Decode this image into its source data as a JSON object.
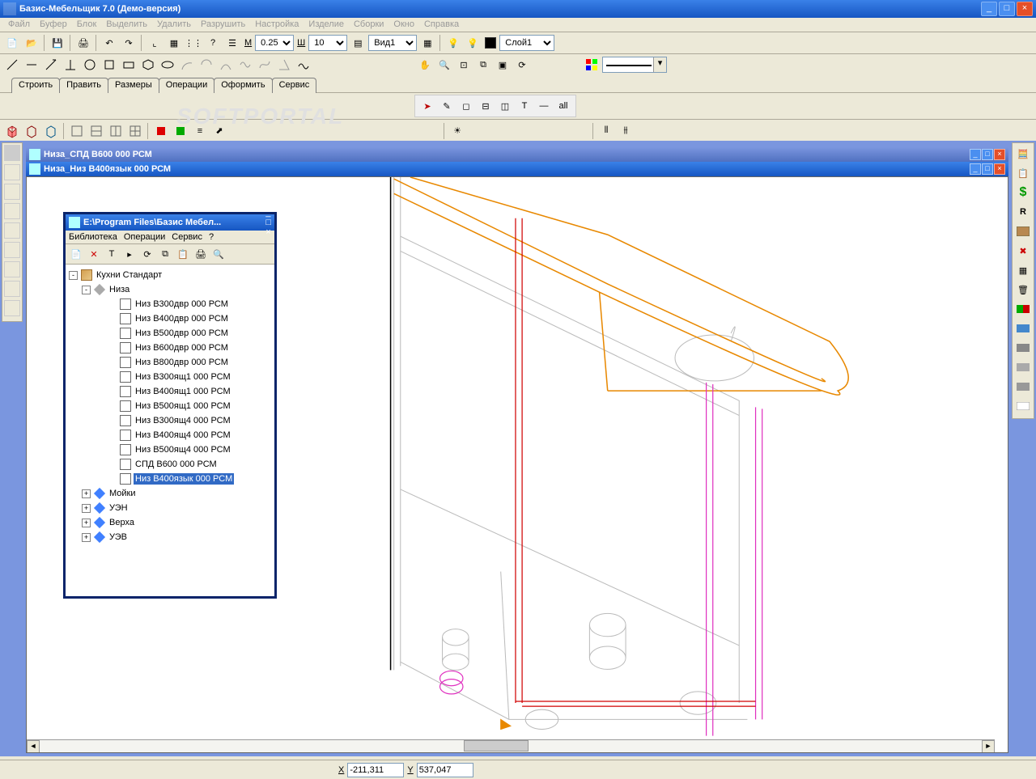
{
  "app": {
    "title": "Базис-Мебельщик 7.0 (Демо-версия)"
  },
  "menubar": [
    "Файл",
    "Буфер",
    "Блок",
    "Выделить",
    "Удалить",
    "Разрушить",
    "Настройка",
    "Изделие",
    "Сборки",
    "Окно",
    "Справка"
  ],
  "toolbar1": {
    "m_label": "М",
    "m_value": "0.25",
    "w_label": "Ш",
    "w_value": "10",
    "view_value": "Вид1",
    "layer_value": "Слой1"
  },
  "tabs": [
    "Строить",
    "Править",
    "Размеры",
    "Операции",
    "Оформить",
    "Сервис"
  ],
  "cursor_toolbar": {
    "all_label": "all"
  },
  "docs": {
    "inactive": "Низа_СПД В600 000 РСМ",
    "active": "Низа_Низ В400язык 000 РСМ"
  },
  "library": {
    "title": "E:\\Program Files\\Базис Мебел...",
    "menu": [
      "Библиотека",
      "Операции",
      "Сервис",
      "?"
    ],
    "root": "Кухни Стандарт",
    "folder": "Низа",
    "items": [
      "Низ В300двр 000 РСМ",
      "Низ В400двр 000 РСМ",
      "Низ В500двр 000 РСМ",
      "Низ В600двр 000 РСМ",
      "Низ В800двр 000 РСМ",
      "Низ В300ящ1 000 РСМ",
      "Низ В400ящ1 000 РСМ",
      "Низ В500ящ1 000 РСМ",
      "Низ В300ящ4 000 РСМ",
      "Низ В400ящ4 000 РСМ",
      "Низ В500ящ4 000 РСМ",
      "СПД В600 000 РСМ",
      "Низ В400язык 000 РСМ"
    ],
    "selected_index": 12,
    "siblings": [
      "Мойки",
      "УЭН",
      "Верха",
      "УЭВ"
    ]
  },
  "status": {
    "x_label": "X",
    "x_value": "-211,311",
    "y_label": "Y",
    "y_value": "537,047"
  },
  "watermark": "SOFTPORTAL"
}
